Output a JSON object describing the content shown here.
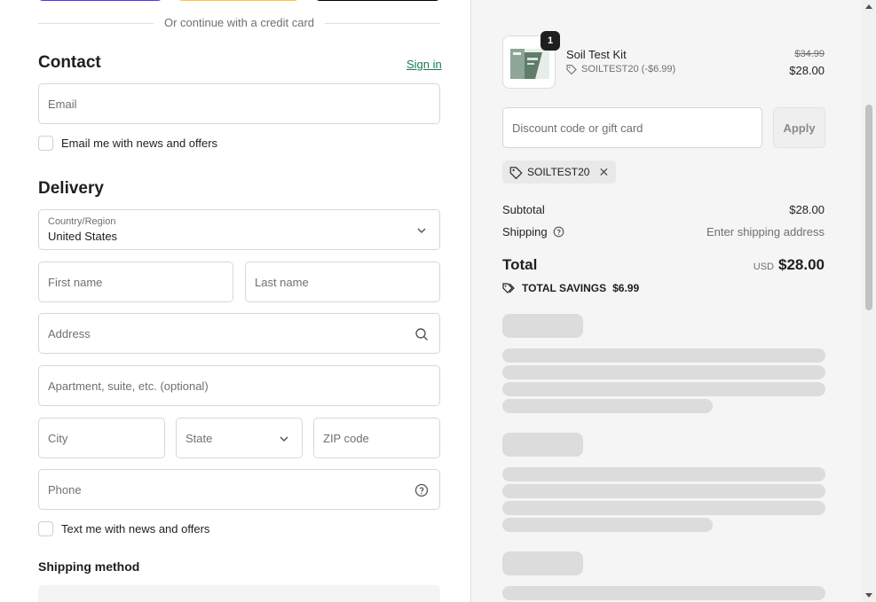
{
  "checkout": {
    "divider_text": "Or continue with a credit card",
    "contact": {
      "heading": "Contact",
      "sign_in": "Sign in",
      "email_placeholder": "Email",
      "newsletter_label": "Email me with news and offers"
    },
    "delivery": {
      "heading": "Delivery",
      "country_label": "Country/Region",
      "country_value": "United States",
      "first_name_placeholder": "First name",
      "last_name_placeholder": "Last name",
      "address_placeholder": "Address",
      "apartment_placeholder": "Apartment, suite, etc. (optional)",
      "city_placeholder": "City",
      "state_placeholder": "State",
      "zip_placeholder": "ZIP code",
      "phone_placeholder": "Phone",
      "sms_label": "Text me with news and offers"
    },
    "shipping_method": {
      "heading": "Shipping method"
    }
  },
  "summary": {
    "product": {
      "quantity": "1",
      "name": "Soil Test Kit",
      "discount_code": "SOILTEST20 (-$6.99)",
      "original_price": "$34.99",
      "price": "$28.00"
    },
    "discount_placeholder": "Discount code or gift card",
    "apply_label": "Apply",
    "applied_code": "SOILTEST20",
    "subtotal_label": "Subtotal",
    "subtotal_value": "$28.00",
    "shipping_label": "Shipping",
    "shipping_value": "Enter shipping address",
    "total_label": "Total",
    "total_currency": "USD",
    "total_value": "$28.00",
    "savings_label": "TOTAL SAVINGS",
    "savings_value": "$6.99"
  },
  "colors": {
    "link": "#1a7a4e",
    "summary_bg": "#f5f5f5",
    "skeleton": "#dcdcdc"
  }
}
